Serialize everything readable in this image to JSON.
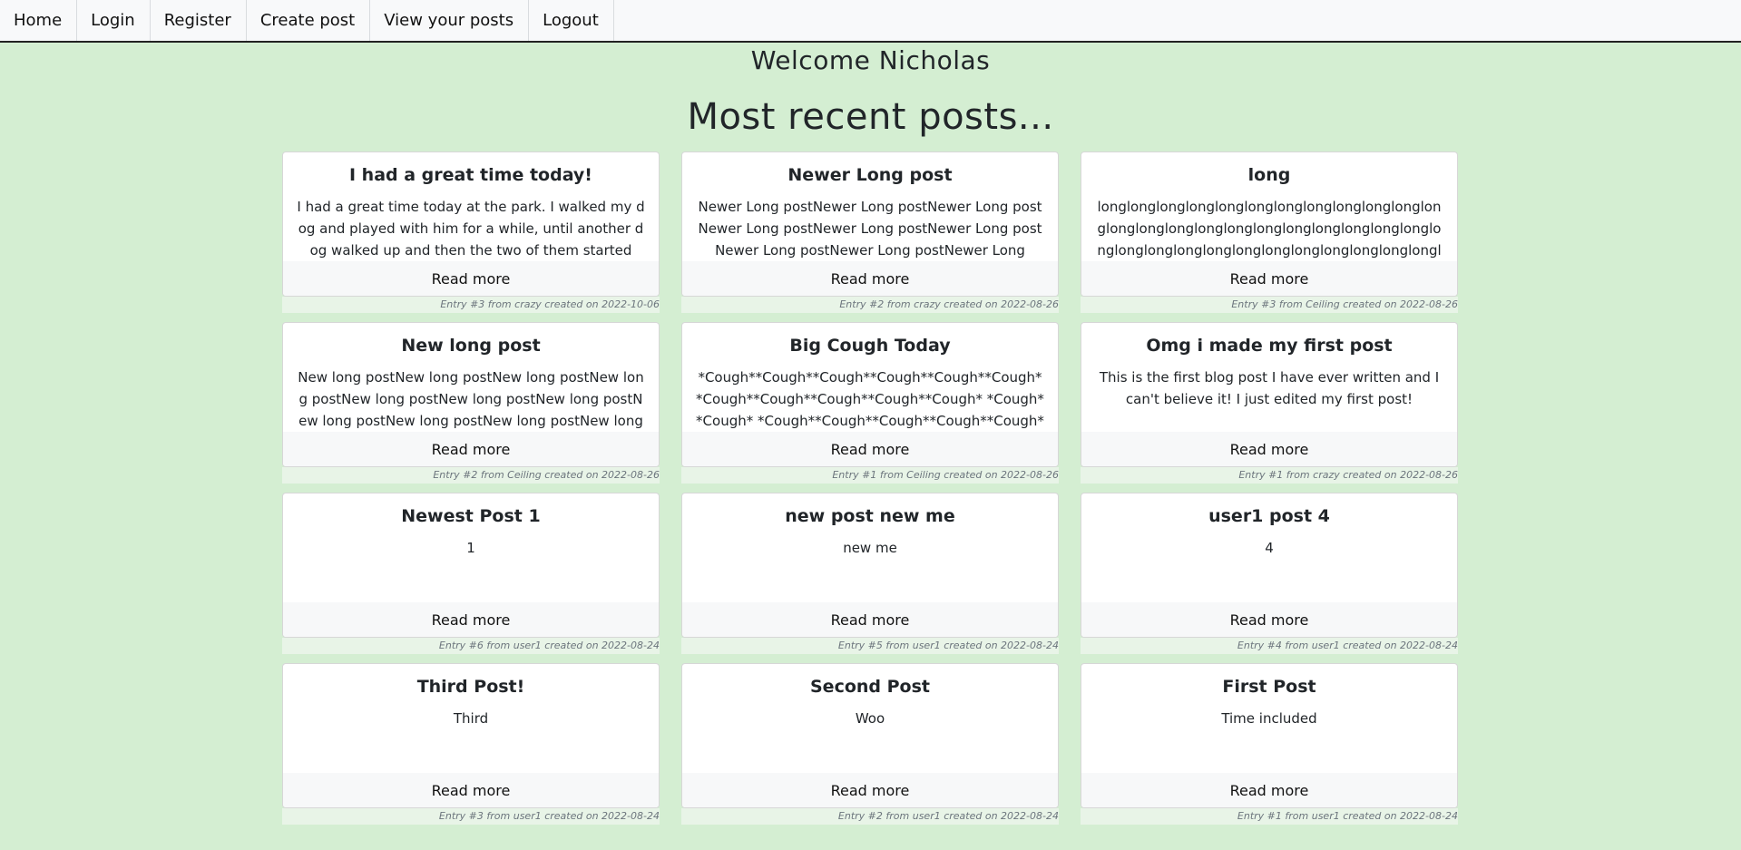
{
  "nav": {
    "items": [
      "Home",
      "Login",
      "Register",
      "Create post",
      "View your posts",
      "Logout"
    ]
  },
  "welcome": "Welcome Nicholas",
  "heading": "Most recent posts...",
  "read_more": "Read more",
  "posts": [
    {
      "title": "I had a great time today!",
      "body": "I had a great time today at the park. I walked my dog and played with him for a while, until another dog walked up and then the two of them started",
      "meta": "Entry #3 from crazy created on 2022-10-06"
    },
    {
      "title": "Newer Long post",
      "body": "Newer Long postNewer Long postNewer Long postNewer Long postNewer Long postNewer Long postNewer Long postNewer Long postNewer Long",
      "meta": "Entry #2 from crazy created on 2022-08-26"
    },
    {
      "title": "long",
      "body": "longlonglonglonglonglonglonglonglonglonglonglonglonglonglonglonglonglonglonglonglonglonglonglonglonglonglonglonglonglonglonglonglonglonglonglonglonglongl",
      "meta": "Entry #3 from Ceiling created on 2022-08-26"
    },
    {
      "title": "New long post",
      "body": "New long postNew long postNew long postNew long postNew long postNew long postNew long postNew long postNew long postNew long postNew long",
      "meta": "Entry #2 from Ceiling created on 2022-08-26"
    },
    {
      "title": "Big Cough Today",
      "body": "*Cough**Cough**Cough**Cough**Cough**Cough**Cough**Cough**Cough**Cough**Cough* *Cough* *Cough* *Cough**Cough**Cough**Cough**Cough**Cough**Cou",
      "meta": "Entry #1 from Ceiling created on 2022-08-26"
    },
    {
      "title": "Omg i made my first post",
      "body": "This is the first blog post I have ever written and I can't believe it! I just edited my first post!",
      "meta": "Entry #1 from crazy created on 2022-08-26"
    },
    {
      "title": "Newest Post 1",
      "body": "1",
      "meta": "Entry #6 from user1 created on 2022-08-24"
    },
    {
      "title": "new post new me",
      "body": "new me",
      "meta": "Entry #5 from user1 created on 2022-08-24"
    },
    {
      "title": "user1 post 4",
      "body": "4",
      "meta": "Entry #4 from user1 created on 2022-08-24"
    },
    {
      "title": "Third Post!",
      "body": "Third",
      "meta": "Entry #3 from user1 created on 2022-08-24"
    },
    {
      "title": "Second Post",
      "body": "Woo",
      "meta": "Entry #2 from user1 created on 2022-08-24"
    },
    {
      "title": "First Post",
      "body": "Time included",
      "meta": "Entry #1 from user1 created on 2022-08-24"
    }
  ]
}
